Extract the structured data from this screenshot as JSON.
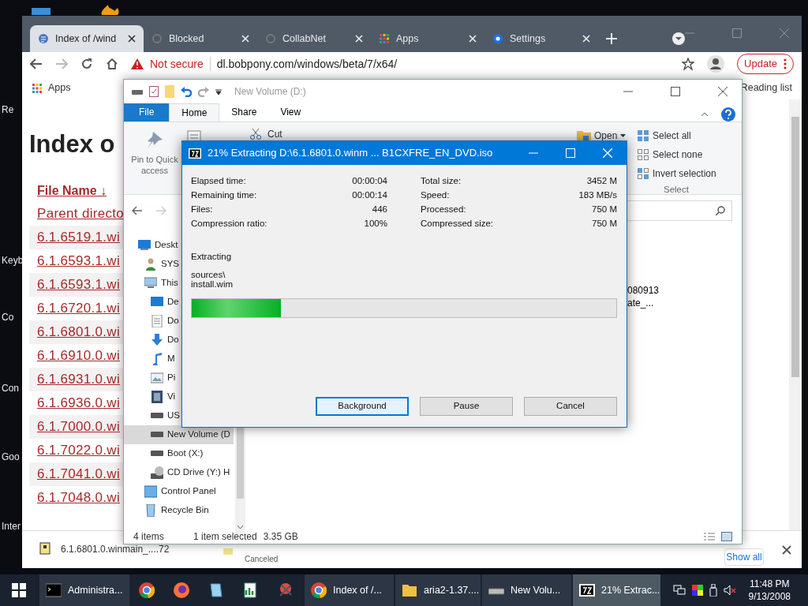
{
  "desktop": {
    "icon_labels": [
      "Re",
      "Keyb",
      "Co",
      "Con",
      "Goo",
      "Inter"
    ]
  },
  "browser": {
    "tabs": [
      {
        "label": "Index of /wind",
        "selected": true
      },
      {
        "label": "Blocked",
        "selected": false
      },
      {
        "label": "CollabNet",
        "selected": false
      },
      {
        "label": "Apps",
        "selected": false
      },
      {
        "label": "Settings",
        "selected": false
      }
    ],
    "address": {
      "security": "Not secure",
      "url": "dl.bobpony.com/windows/beta/7/x64/"
    },
    "update_button": "Update",
    "bookmarks": [
      {
        "label": "Apps"
      }
    ],
    "reading_list": "Reading list",
    "page": {
      "heading": "Index o",
      "sort_column": "File Name ↓",
      "links": [
        "Parent directo",
        "6.1.6519.1.wi",
        "6.1.6593.1.wi",
        "6.1.6593.1.wi",
        "6.1.6720.1.wi",
        "6.1.6801.0.wi",
        "6.1.6910.0.wi",
        "6.1.6931.0.wi",
        "6.1.6936.0.wi",
        "6.1.7000.0.wi",
        "6.1.7022.0.wi",
        "6.1.7041.0.wi",
        "6.1.7048.0.wi"
      ]
    },
    "downloads": [
      {
        "name": "6.1.6801.0.winmain_....72"
      },
      {
        "status": "Canceled"
      }
    ],
    "show_all": "Show all"
  },
  "explorer": {
    "title": "New Volume (D:)",
    "ribbon_tabs": [
      {
        "label": "File",
        "kind": "menu",
        "selected": false
      },
      {
        "label": "Home",
        "kind": "tab",
        "selected": true
      },
      {
        "label": "Share",
        "kind": "tab",
        "selected": false
      },
      {
        "label": "View",
        "kind": "tab",
        "selected": false
      }
    ],
    "ribbon": {
      "pin": "Pin to Quick access",
      "cut": "Cut",
      "open": "Open",
      "select_items": [
        "Select all",
        "Select none",
        "Invert selection"
      ],
      "select_group": "Select"
    },
    "nav": [
      {
        "label": "Deskt",
        "selected": false,
        "children": [
          {
            "label": "SYS",
            "selected": false
          },
          {
            "label": "This",
            "selected": false,
            "children": [
              {
                "label": "De",
                "selected": false
              },
              {
                "label": "Do",
                "selected": false
              },
              {
                "label": "Do",
                "selected": false
              },
              {
                "label": "M",
                "selected": false
              },
              {
                "label": "Pi",
                "selected": false
              },
              {
                "label": "Vi",
                "selected": false
              },
              {
                "label": "US",
                "selected": false
              },
              {
                "label": "New Volume (D",
                "selected": true
              },
              {
                "label": "Boot (X:)",
                "selected": false
              },
              {
                "label": "CD Drive (Y:) H",
                "selected": false
              }
            ]
          },
          {
            "label": "Control Panel",
            "selected": false
          },
          {
            "label": "Recycle Bin",
            "selected": false
          }
        ]
      }
    ],
    "file_fragments": [
      "080913",
      "ate_..."
    ],
    "status": {
      "count": "4 items",
      "selection": "1 item selected",
      "size": "3.35 GB"
    }
  },
  "dialog": {
    "title": "21% Extracting D:\\6.1.6801.0.winm ... B1CXFRE_EN_DVD.iso",
    "stats_left": [
      {
        "label": "Elapsed time:",
        "value": "00:00:04"
      },
      {
        "label": "Remaining time:",
        "value": "00:00:14"
      },
      {
        "label": "Files:",
        "value": "446"
      },
      {
        "label": "Compression ratio:",
        "value": "100%"
      }
    ],
    "stats_right": [
      {
        "label": "Total size:",
        "value": "3452 M"
      },
      {
        "label": "Speed:",
        "value": "183 MB/s"
      },
      {
        "label": "Processed:",
        "value": "750 M"
      },
      {
        "label": "Compressed size:",
        "value": "750 M"
      }
    ],
    "operation": "Extracting",
    "current_path": "sources\\",
    "current_file": "install.wim",
    "progress": {
      "level": 0.21
    },
    "buttons": [
      {
        "label": "Background",
        "selected": true
      },
      {
        "label": "Pause",
        "selected": false
      },
      {
        "label": "Cancel",
        "selected": false
      }
    ]
  },
  "taskbar": {
    "items": [
      {
        "kind": "window",
        "label": "Administra...",
        "selected": false
      },
      {
        "kind": "pinned"
      },
      {
        "kind": "pinned"
      },
      {
        "kind": "pinned"
      },
      {
        "kind": "pinned"
      },
      {
        "kind": "pinned"
      },
      {
        "kind": "window",
        "label": "Index of /...",
        "selected": false
      },
      {
        "kind": "window",
        "label": "aria2-1.37....",
        "selected": false
      },
      {
        "kind": "window",
        "label": "New Volu...",
        "selected": false
      },
      {
        "kind": "window",
        "label": "21% Extrac...",
        "selected": true
      }
    ],
    "time": "11:48 PM",
    "date": "9/13/2008"
  }
}
